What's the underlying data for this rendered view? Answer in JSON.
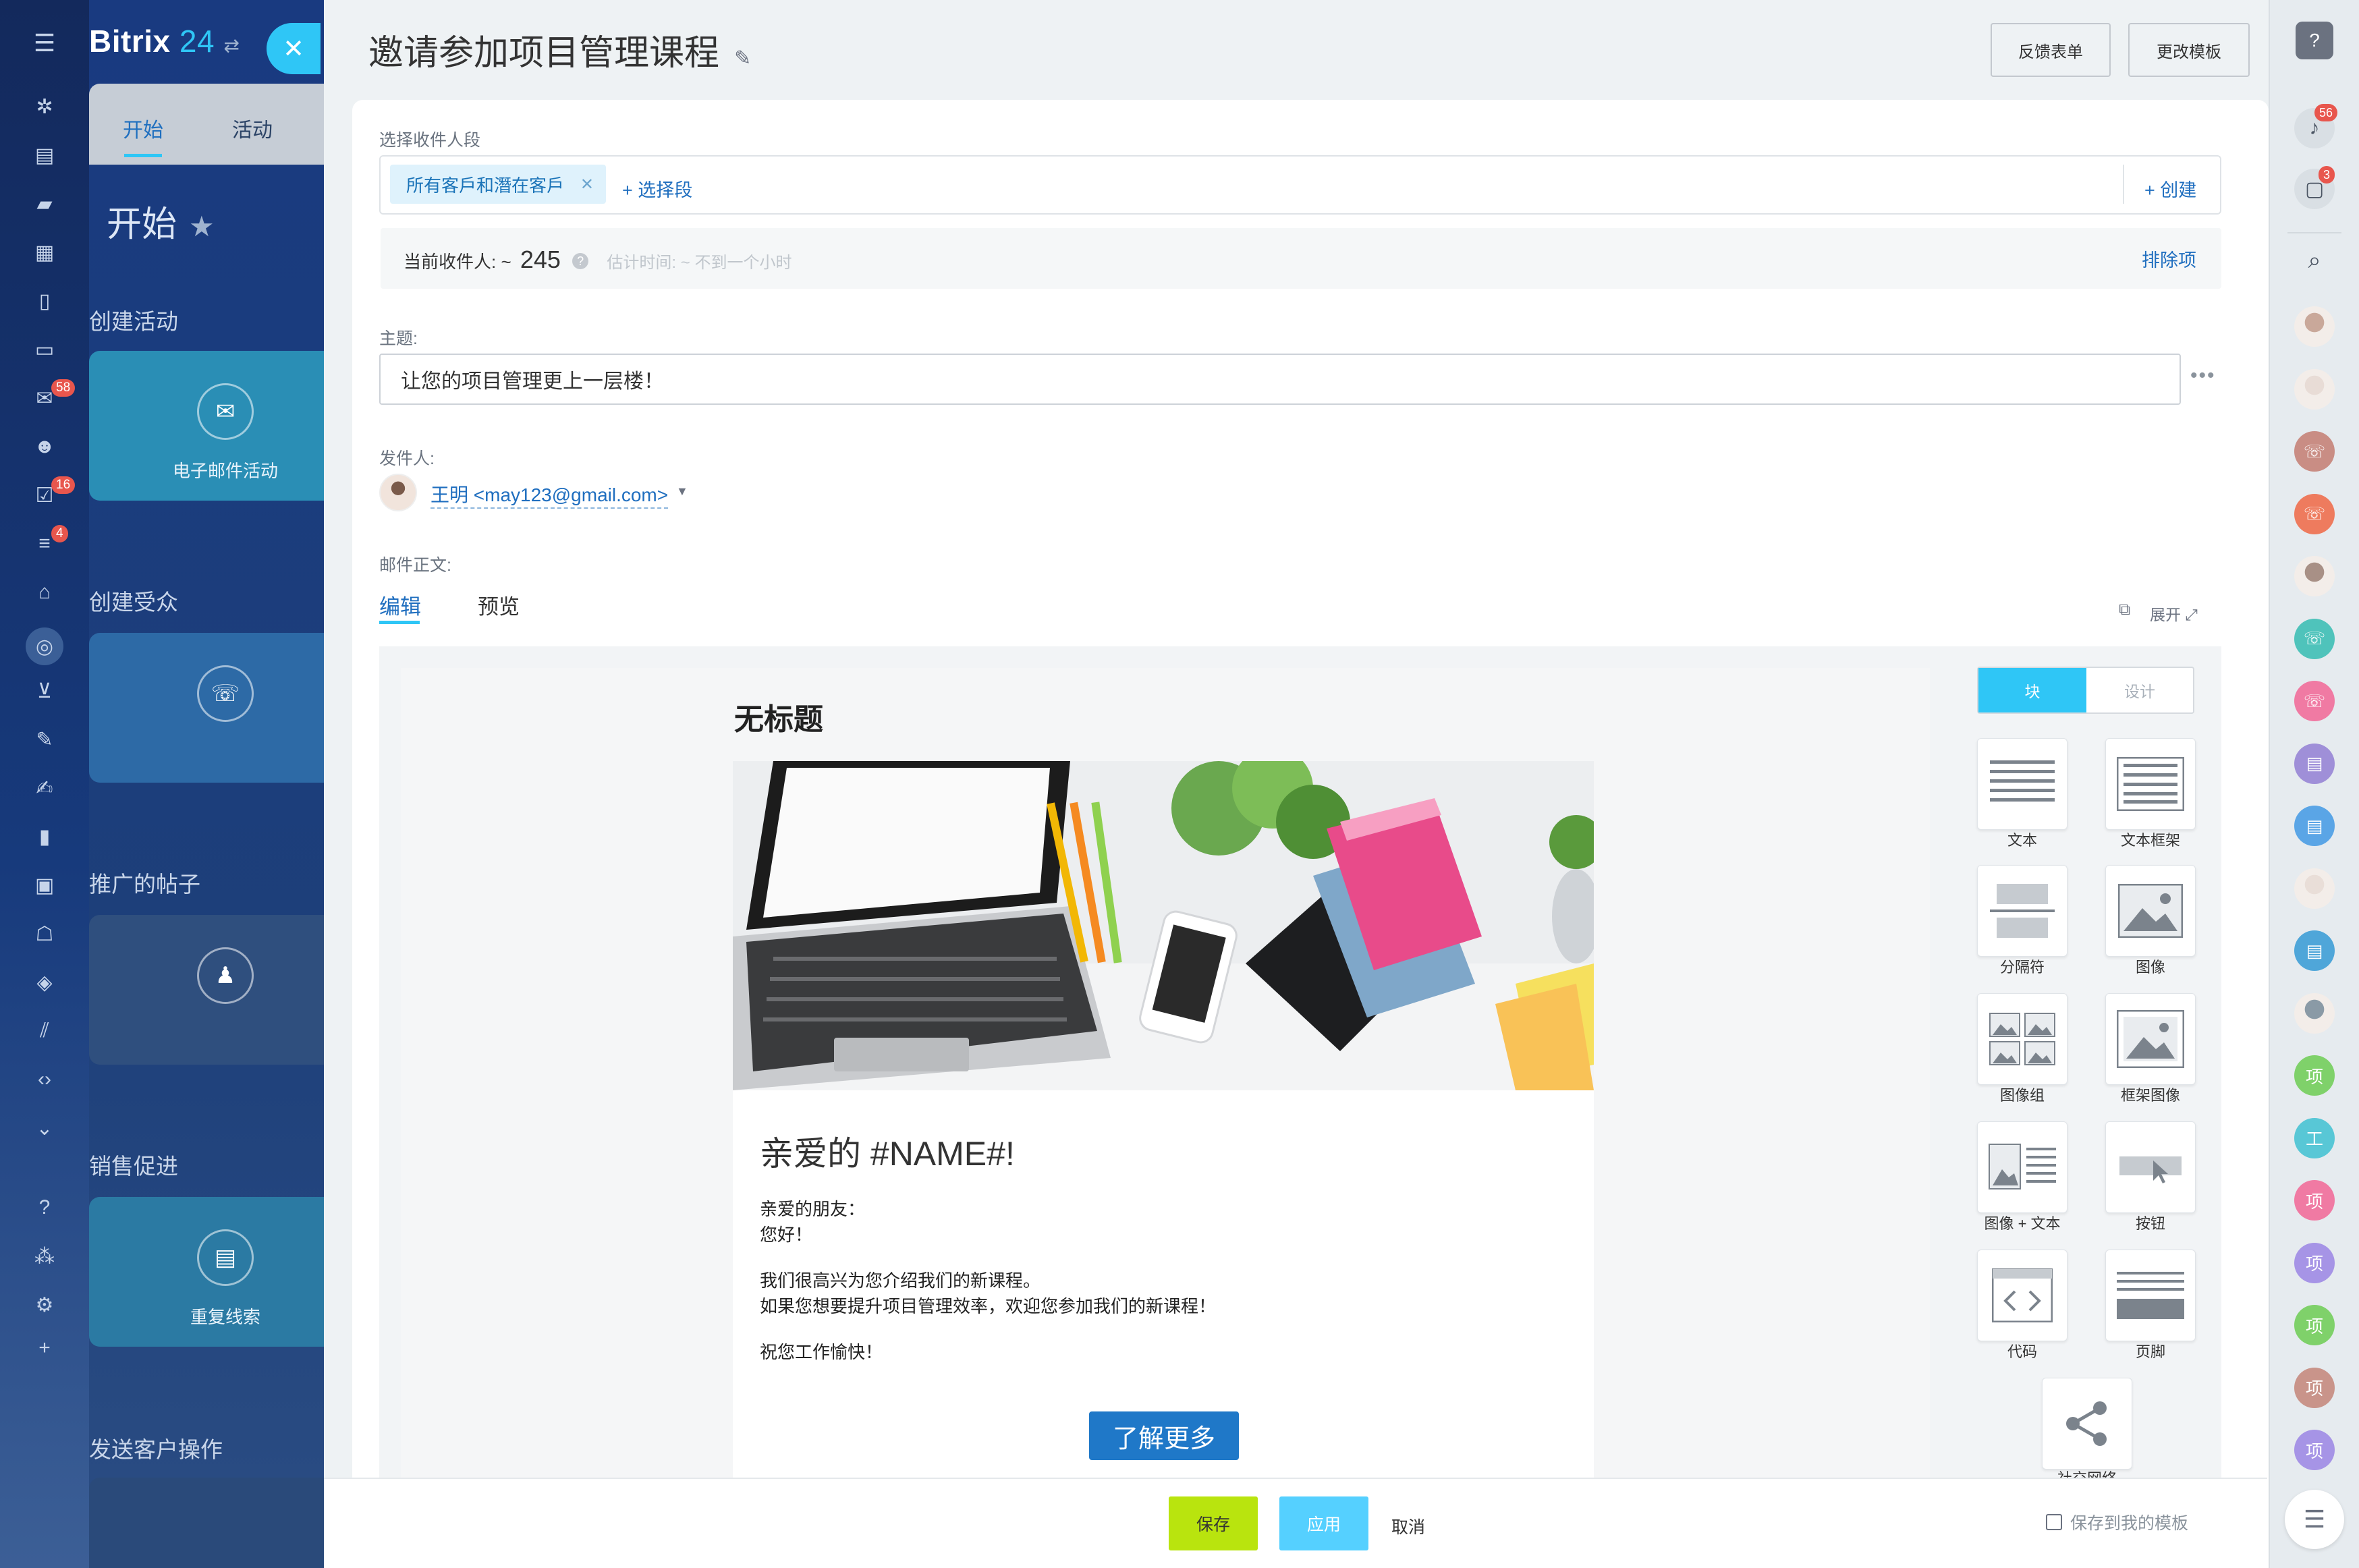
{
  "app": {
    "brand": "Bitrix",
    "brand_num": "24"
  },
  "left_rail": {
    "badges": {
      "mail": "58",
      "tasks": "16",
      "filter": "4"
    }
  },
  "workspace": {
    "tabs": [
      "开始",
      "活动"
    ],
    "title": "开始",
    "sections": [
      {
        "heading": "创建活动",
        "card_label": "电子邮件活动",
        "icon": "mail-icon",
        "color": "#2a8eb5"
      },
      {
        "heading": "创建受众",
        "card_label": "",
        "icon": "phone-icon",
        "color": "#2d6aa6"
      },
      {
        "heading": "推广的帖子",
        "card_label": "",
        "icon": "user-post-icon",
        "color": "#2f4f7e"
      },
      {
        "heading": "销售促进",
        "card_label": "重复线索",
        "icon": "lead-icon",
        "color": "#2b7aa3"
      },
      {
        "heading": "发送客户操作",
        "card_label": "",
        "icon": "",
        "color": "#2a4a7a"
      }
    ]
  },
  "page": {
    "title": "邀请参加项目管理课程",
    "buttons": {
      "feedback": "反馈表单",
      "change_template": "更改模板"
    }
  },
  "recipients": {
    "label": "选择收件人段",
    "segment_chip": "所有客戶和潛在客戶",
    "select_segment": "+ 选择段",
    "create": "+ 创建",
    "current_label": "当前收件人: ~",
    "current_count": "245",
    "estimate": "估计时间: ~ 不到一个小时",
    "exclude": "排除项"
  },
  "subject": {
    "label": "主题:",
    "value": "让您的项目管理更上一层楼！"
  },
  "sender": {
    "label": "发件人:",
    "value": "王明 <may123@gmail.com>"
  },
  "body": {
    "label": "邮件正文:",
    "tabs": [
      "编辑",
      "预览"
    ],
    "expand": "展开"
  },
  "email": {
    "title": "无标题",
    "greeting": "亲爱的 #NAME#!",
    "lines": [
      "亲爱的朋友：",
      "您好！",
      "我们很高兴为您介绍我们的新课程。",
      "如果您想要提升项目管理效率，欢迎您参加我们的新课程！",
      "祝您工作愉快！"
    ],
    "cta": "了解更多"
  },
  "blocks_panel": {
    "toggle": [
      "块",
      "设计"
    ],
    "blocks": [
      "文本",
      "文本框架",
      "分隔符",
      "图像",
      "图像组",
      "框架图像",
      "图像 + 文本",
      "按钮",
      "代码",
      "页脚",
      "社交网络"
    ]
  },
  "footer": {
    "save": "保存",
    "apply": "应用",
    "cancel": "取消",
    "save_template": "保存到我的模板",
    "colors": {
      "save": "#b9e40e",
      "apply": "#55d0ff"
    }
  },
  "right_rail": {
    "badges": {
      "notifications": "56",
      "chat": "3"
    },
    "contacts": [
      {
        "type": "photo",
        "color": "#c9a89a",
        "text": ""
      },
      {
        "type": "photo",
        "color": "#e8dcd6",
        "text": ""
      },
      {
        "type": "icon",
        "color": "#c98d84",
        "text": "☏"
      },
      {
        "type": "icon",
        "color": "#ee7b5e",
        "text": "☏"
      },
      {
        "type": "photo",
        "color": "#a89086",
        "text": ""
      },
      {
        "type": "icon",
        "color": "#4fc3bb",
        "text": "☏"
      },
      {
        "type": "icon",
        "color": "#f07aa3",
        "text": "☏"
      },
      {
        "type": "icon",
        "color": "#9f8fd8",
        "text": "▤"
      },
      {
        "type": "icon",
        "color": "#5aa5e6",
        "text": "▤"
      },
      {
        "type": "photo",
        "color": "#e9ded8",
        "text": ""
      },
      {
        "type": "icon",
        "color": "#4fa6d9",
        "text": "▤"
      },
      {
        "type": "photo",
        "color": "#8a9aa6",
        "text": ""
      },
      {
        "type": "text",
        "color": "#7fd16a",
        "text": "项"
      },
      {
        "type": "text",
        "color": "#58c7d6",
        "text": "工"
      },
      {
        "type": "text",
        "color": "#f07aa3",
        "text": "项"
      },
      {
        "type": "text",
        "color": "#a694e6",
        "text": "项"
      },
      {
        "type": "text",
        "color": "#7fd16a",
        "text": "项"
      },
      {
        "type": "text",
        "color": "#c9948a",
        "text": "项"
      },
      {
        "type": "text",
        "color": "#a694e6",
        "text": "项"
      }
    ]
  }
}
